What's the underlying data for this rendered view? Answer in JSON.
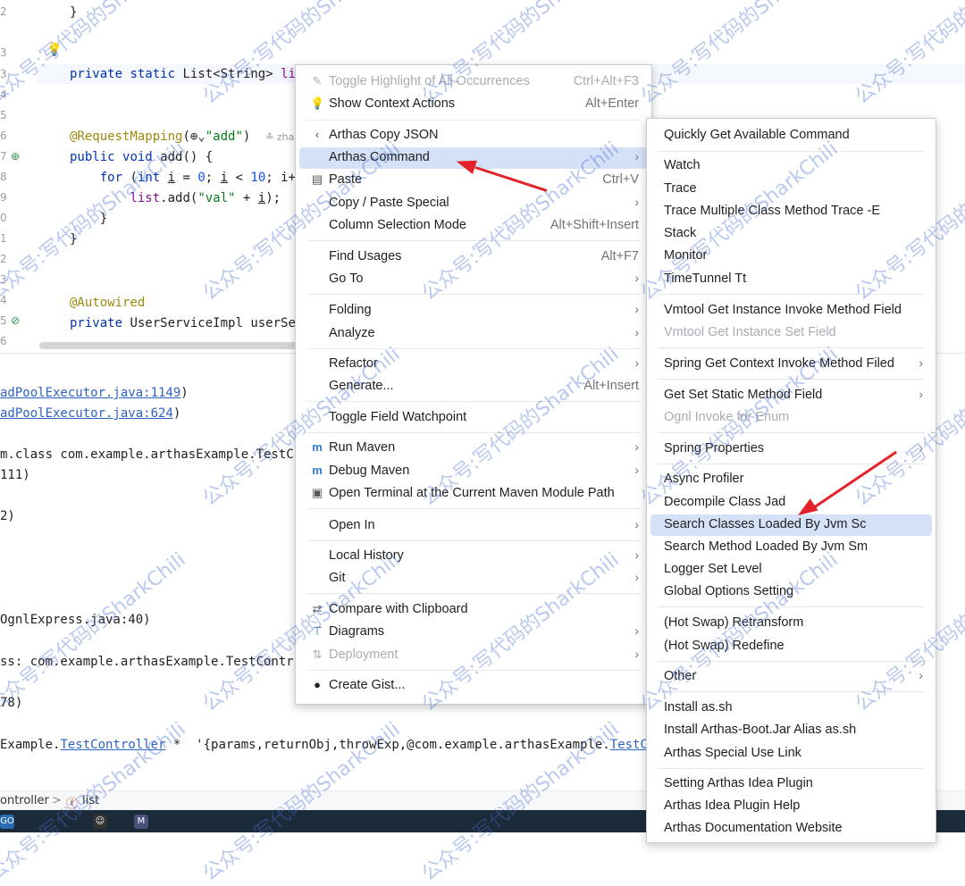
{
  "editor": {
    "gutter": [
      "2",
      "3",
      "4",
      "5",
      "6",
      "7",
      "8",
      "9",
      "0",
      "1",
      "2",
      "3",
      "4",
      "5",
      "6"
    ],
    "line_close_brace": "}",
    "private_kw": "private",
    "static_kw": "static",
    "list_type": "List<String>",
    "list_name": "li",
    "annotation_request": "@RequestMapping",
    "mapping_open": "(",
    "mapping_value": "\"add\"",
    "mapping_close": ")",
    "author_hint": "zha",
    "public_kw": "public",
    "void_kw": "void",
    "method_sig": "add() {",
    "for_kw": "for",
    "for_open": "(",
    "int_kw": "int",
    "for_var_i": "i",
    "for_eq": " = ",
    "for_zero": "0",
    "for_mid": "; ",
    "for_i2": "i",
    "for_lt": " < ",
    "for_ten": "10",
    "for_rest": "; i+",
    "list_field": "list",
    "add_call": ".add(",
    "val_str": "\"val\"",
    "add_plus": " + ",
    "add_i": "i",
    "add_end": ");",
    "inner_close": "}",
    "outer_close": "}",
    "autowired": "@Autowired",
    "private_kw2": "private",
    "user_service": "UserServiceImpl userSe"
  },
  "console": {
    "lines": [
      {
        "pre": "",
        "link": "adPoolExecutor.java:1149",
        "post": ")"
      },
      {
        "pre": "",
        "link": "adPoolExecutor.java:624",
        "post": ")"
      },
      {
        "pre": "m.class com.example.arthasExample.TestC",
        "link": "",
        "post": ""
      },
      {
        "pre": "111)",
        "link": "",
        "post": ""
      },
      {
        "pre": "2)",
        "link": "",
        "post": ""
      },
      {
        "pre": "OgnlExpress.java:40)",
        "link": "",
        "post": ""
      },
      {
        "pre": "ss: com.example.arthasExample.TestContr",
        "link": "",
        "post": ""
      },
      {
        "pre": "78)",
        "link": "",
        "post": ""
      },
      {
        "pre": "Example.",
        "link": "TestController",
        "post": " *  '{params,returnObj,throwExp,@com.example.arthasExample.",
        "link2": "TestC"
      }
    ]
  },
  "breadcrumb": {
    "left": "ontroller",
    "sep": ">",
    "right": "list"
  },
  "taskbar": {
    "go_label": "GO",
    "m_label": "M"
  },
  "context_menu": {
    "items": [
      {
        "label": "Toggle Highlight of All Occurrences",
        "shortcut": "Ctrl+Alt+F3",
        "icon": "✎",
        "disabled": true
      },
      {
        "label": "Show Context Actions",
        "shortcut": "Alt+Enter",
        "icon": "💡"
      },
      {
        "label": "Arthas Copy JSON",
        "icon": "‹"
      },
      {
        "label": "Arthas Command",
        "arrow": "›",
        "selected": true
      },
      {
        "label": "Paste",
        "shortcut": "Ctrl+V",
        "icon": "▤"
      },
      {
        "label": "Copy / Paste Special",
        "arrow": "›"
      },
      {
        "label": "Column Selection Mode",
        "shortcut": "Alt+Shift+Insert"
      },
      {
        "label": "Find Usages",
        "shortcut": "Alt+F7"
      },
      {
        "label": "Go To",
        "arrow": "›"
      },
      {
        "label": "Folding",
        "arrow": "›"
      },
      {
        "label": "Analyze",
        "arrow": "›"
      },
      {
        "label": "Refactor",
        "arrow": "›"
      },
      {
        "label": "Generate...",
        "shortcut": "Alt+Insert"
      },
      {
        "label": "Toggle Field Watchpoint"
      },
      {
        "label": "Run Maven",
        "icon": "m",
        "arrow": "›"
      },
      {
        "label": "Debug Maven",
        "icon": "m",
        "arrow": "›"
      },
      {
        "label": "Open Terminal at the Current Maven Module Path",
        "icon": "▣"
      },
      {
        "label": "Open In",
        "arrow": "›"
      },
      {
        "label": "Local History",
        "arrow": "›"
      },
      {
        "label": "Git",
        "arrow": "›"
      },
      {
        "label": "Compare with Clipboard",
        "icon": "⇄"
      },
      {
        "label": "Diagrams",
        "icon": "⊤",
        "arrow": "›"
      },
      {
        "label": "Deployment",
        "icon": "⇅",
        "arrow": "›",
        "disabled": true
      },
      {
        "label": "Create Gist...",
        "icon": "●"
      }
    ]
  },
  "submenu": {
    "items": [
      {
        "label": "Quickly Get Available Command"
      },
      {
        "label": "Watch"
      },
      {
        "label": "Trace"
      },
      {
        "label": "Trace Multiple Class Method Trace -E"
      },
      {
        "label": "Stack"
      },
      {
        "label": "Monitor"
      },
      {
        "label": "TimeTunnel Tt"
      },
      {
        "label": "Vmtool Get Instance Invoke Method Field"
      },
      {
        "label": "Vmtool Get Instance Set Field",
        "disabled": true
      },
      {
        "label": "Spring Get Context Invoke Method Filed",
        "arrow": "›"
      },
      {
        "label": "Get Set Static Method Field",
        "arrow": "›"
      },
      {
        "label": "Ognl Invoke for Enum",
        "disabled": true
      },
      {
        "label": "Spring Properties",
        "arrow": "›"
      },
      {
        "label": "Async Profiler"
      },
      {
        "label": "Decompile Class Jad"
      },
      {
        "label": "Search Classes Loaded By Jvm Sc",
        "selected": true
      },
      {
        "label": "Search Method Loaded By Jvm Sm"
      },
      {
        "label": "Logger Set Level"
      },
      {
        "label": "Global Options Setting"
      },
      {
        "label": "(Hot Swap) Retransform"
      },
      {
        "label": "(Hot Swap) Redefine"
      },
      {
        "label": "Other",
        "arrow": "›"
      },
      {
        "label": "Install as.sh"
      },
      {
        "label": "Install Arthas-Boot.Jar Alias as.sh"
      },
      {
        "label": "Arthas Special Use Link"
      },
      {
        "label": "Setting Arthas Idea Plugin"
      },
      {
        "label": "Arthas Idea Plugin Help"
      },
      {
        "label": "Arthas Documentation Website"
      }
    ]
  },
  "watermark_text": "公众号:写代码的SharkChili",
  "colors": {
    "selection": "#d5e1f7",
    "annotation_arrow": "#e4222a",
    "keyword": "#0033b3",
    "string": "#067d17",
    "link": "#2e63c4"
  }
}
